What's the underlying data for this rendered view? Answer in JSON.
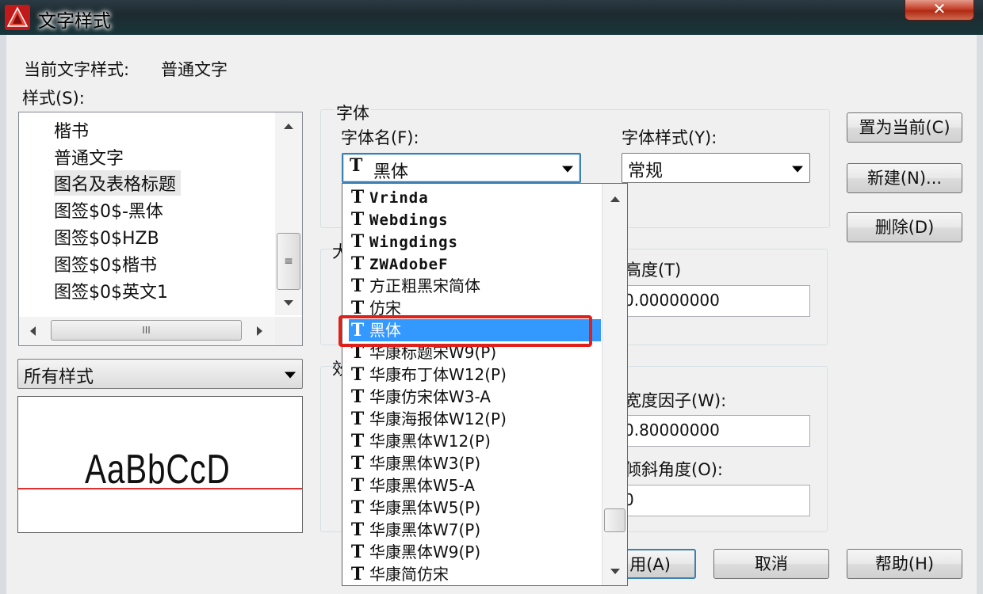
{
  "window": {
    "title": "文字样式",
    "close_label": "✕"
  },
  "current_style": {
    "label": "当前文字样式:",
    "value": "普通文字"
  },
  "styles": {
    "label": "样式(S):",
    "items": [
      "楷书",
      "普通文字",
      "图名及表格标题",
      "图签$0$-黑体",
      "图签$0$HZB",
      "图签$0$楷书",
      "图签$0$英文1"
    ],
    "selected_index": 2,
    "scroll_thumb": "≡",
    "hscroll_thumb": "III"
  },
  "filter": {
    "value": "所有样式"
  },
  "preview": {
    "text": "AaBbCcD"
  },
  "font_group": {
    "label": "字体",
    "font_name_label": "字体名(F):",
    "font_name_value": "黑体",
    "font_style_label": "字体样式(Y):",
    "font_style_value": "常规"
  },
  "font_dropdown": {
    "items": [
      "Vrinda",
      "Webdings",
      "Wingdings",
      "ZWAdobeF",
      "方正粗黑宋简体",
      "仿宋",
      "黑体",
      "华康标题宋W9(P)",
      "华康布丁体W12(P)",
      "华康仿宋体W3-A",
      "华康海报体W12(P)",
      "华康黑体W12(P)",
      "华康黑体W3(P)",
      "华康黑体W5-A",
      "华康黑体W5(P)",
      "华康黑体W7(P)",
      "华康黑体W9(P)",
      "华康简仿宋"
    ],
    "selected_index": 6
  },
  "size_group": {
    "partial_label": "大",
    "height_label": "高度(T)",
    "height_value": "0.00000000"
  },
  "effects_group": {
    "partial_label": "效",
    "width_label": "宽度因子(W):",
    "width_value": "0.80000000",
    "oblique_label": "倾斜角度(O):",
    "oblique_value": "0"
  },
  "buttons": {
    "set_current": "置为当前(C)",
    "new": "新建(N)...",
    "delete": "删除(D)",
    "apply": "用(A)",
    "cancel": "取消",
    "help": "帮助(H)"
  },
  "colors": {
    "selection": "#3399ff",
    "highlight_box": "#e0201a",
    "preview_baseline": "#e03030"
  }
}
